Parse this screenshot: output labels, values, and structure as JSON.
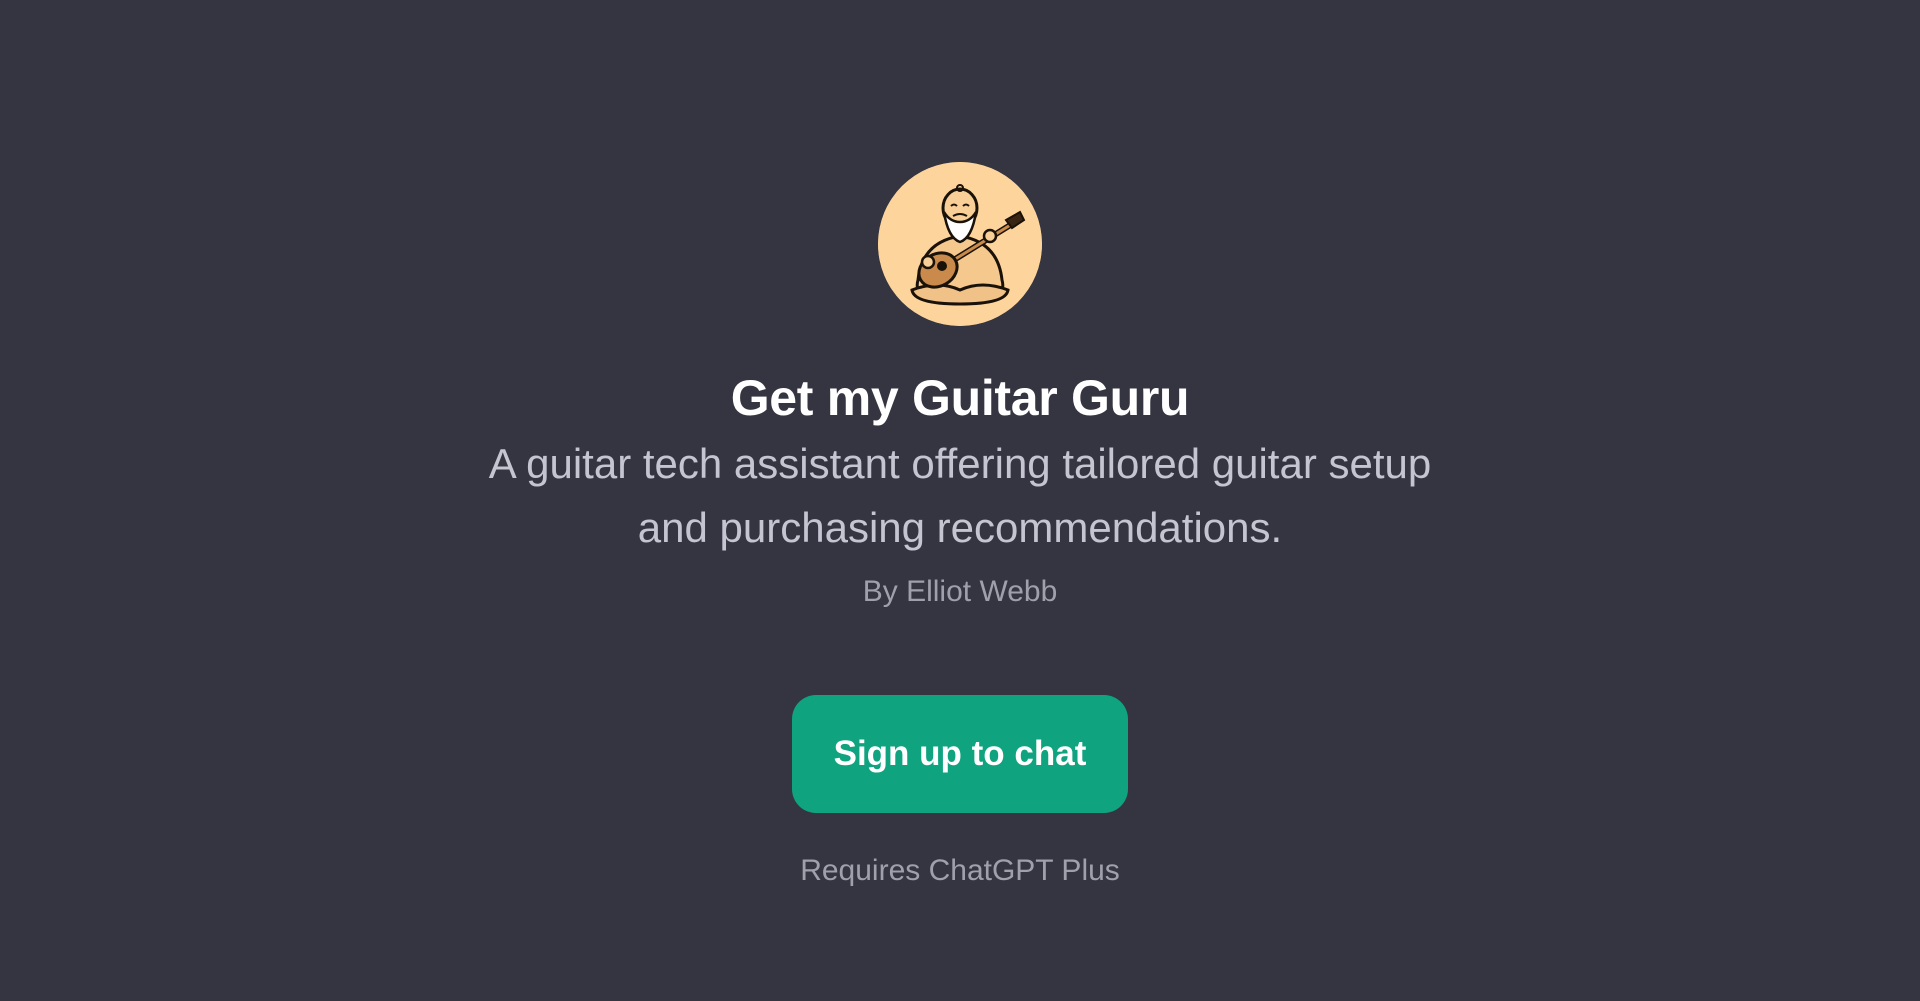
{
  "gpt": {
    "avatar_icon": "guitar-guru-avatar-icon",
    "title": "Get my Guitar Guru",
    "description": "A guitar tech assistant offering tailored guitar setup and purchasing recommendations.",
    "author": "By Elliot Webb"
  },
  "cta": {
    "button_label": "Sign up to chat",
    "requirement": "Requires ChatGPT Plus"
  },
  "colors": {
    "background": "#343541",
    "accent": "#10a37f",
    "avatar_background": "#fdd49b"
  }
}
